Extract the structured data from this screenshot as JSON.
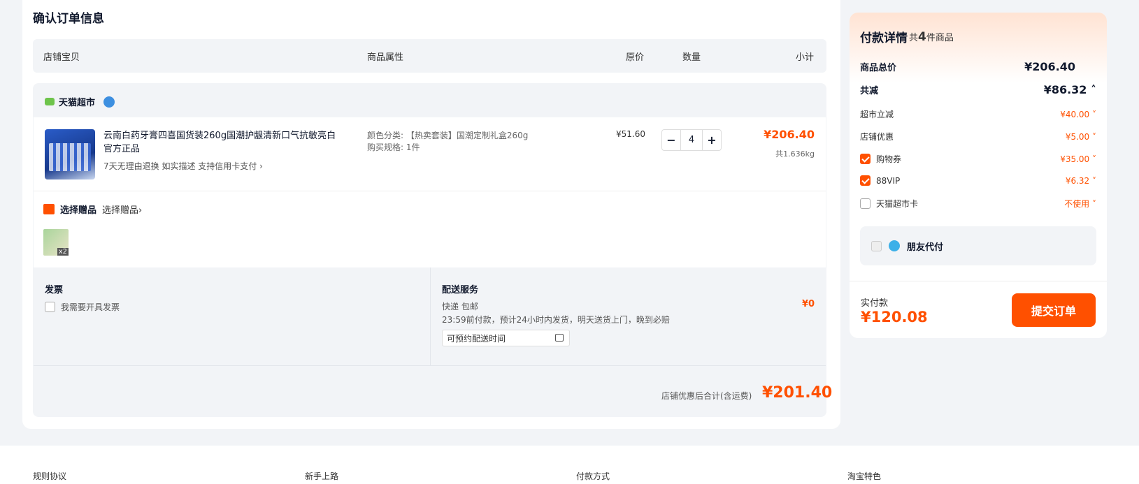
{
  "page_title": "确认订单信息",
  "columns": [
    "店铺宝贝",
    "商品属性",
    "原价",
    "数量",
    "小计"
  ],
  "shop": {
    "name": "天猫超市"
  },
  "item": {
    "title": "云南白药牙膏四喜国货装260g国潮护龈清新口气抗敏亮白官方正品",
    "services": "7天无理由退换   如实描述   支持信用卡支付 ›",
    "attr_color": "颜色分类: 【热卖套装】国潮定制礼盒260g",
    "attr_spec": "购买规格: 1件",
    "price": "¥51.60",
    "minus": "−",
    "qty": "4",
    "plus": "+",
    "subtotal": "¥206.40",
    "weight": "共1.636kg"
  },
  "gift": {
    "label": "选择赠品",
    "link": "选择赠品›",
    "count": "x2"
  },
  "invoice": {
    "title": "发票",
    "option": "我需要开具发票"
  },
  "delivery": {
    "title": "配送服务",
    "line1": "快递 包邮",
    "line2": "23:59前付款，预计24小时内发货，明天送货上门，晚到必赔",
    "time_placeholder": "可预约配送时间",
    "fee": "¥0"
  },
  "shop_total": {
    "label": "店铺优惠后合计(含运费)",
    "value": "¥201.40"
  },
  "summary": {
    "title": "付款详情",
    "count_prefix": "共",
    "count": "4",
    "count_suffix": "件商品",
    "goods_total_label": "商品总价",
    "goods_total": "¥206.40",
    "discount_label": "共减",
    "discount": "¥86.32 ˄",
    "rows": [
      {
        "label": "超市立减",
        "value": "¥40.00 ˅"
      },
      {
        "label": "店铺优惠",
        "value": "¥5.00 ˅"
      },
      {
        "label": "购物券",
        "value": "¥35.00 ˅"
      },
      {
        "label": "88VIP",
        "value": "¥6.32 ˅"
      },
      {
        "label": "天猫超市卡",
        "value": "不使用 ˅"
      }
    ],
    "friend_pay": "朋友代付",
    "paid_label": "实付款",
    "paid": "¥120.08",
    "submit": "提交订单"
  },
  "footer": [
    "规则协议",
    "新手上路",
    "付款方式",
    "淘宝特色"
  ],
  "colors": {
    "accent": "#ff5000",
    "bg": "#f2f4f7"
  }
}
